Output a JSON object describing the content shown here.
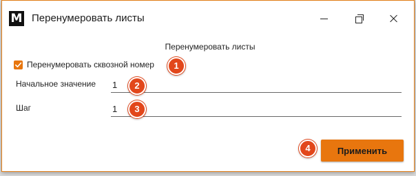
{
  "window": {
    "logo_letter": "M",
    "title": "Перенумеровать листы"
  },
  "form": {
    "heading": "Перенумеровать листы",
    "checkbox": {
      "label": "Перенумеровать сквозной номер",
      "checked": true
    },
    "fields": [
      {
        "label": "Начальное значение",
        "value": "1"
      },
      {
        "label": "Шаг",
        "value": "1"
      }
    ],
    "apply_label": "Применить"
  },
  "badges": [
    "1",
    "2",
    "3",
    "4"
  ],
  "colors": {
    "accent": "#e8760e",
    "badge": "#e2471b",
    "window_border": "#e07a10"
  },
  "icons": {
    "minimize": "minimize-icon",
    "maximize": "restore-icon",
    "close": "close-icon",
    "checkbox": "checkmark-icon"
  }
}
